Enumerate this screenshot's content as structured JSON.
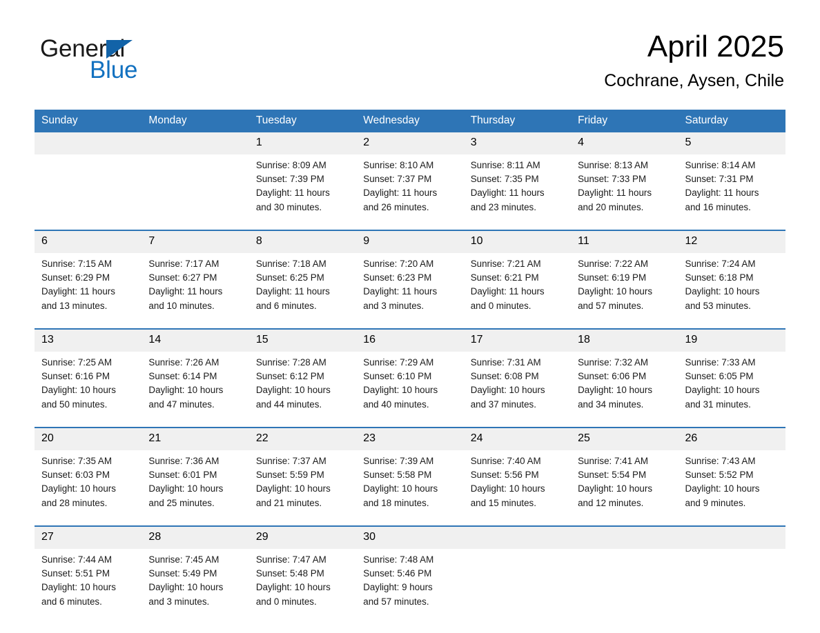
{
  "brand": {
    "name_part1": "General",
    "name_part2": "Blue",
    "triangle_color": "#1263a8",
    "blue_text_color": "#1271c0"
  },
  "header": {
    "month_title": "April 2025",
    "location": "Cochrane, Aysen, Chile",
    "header_bg_color": "#2e75b6",
    "daynum_bg_color": "#f0f0f0"
  },
  "weekday_headers": [
    "Sunday",
    "Monday",
    "Tuesday",
    "Wednesday",
    "Thursday",
    "Friday",
    "Saturday"
  ],
  "weeks": [
    {
      "days": [
        {
          "num": "",
          "sunrise": "",
          "sunset": "",
          "daylight_line1": "",
          "daylight_line2": "",
          "empty": true
        },
        {
          "num": "",
          "sunrise": "",
          "sunset": "",
          "daylight_line1": "",
          "daylight_line2": "",
          "empty": true
        },
        {
          "num": "1",
          "sunrise": "Sunrise: 8:09 AM",
          "sunset": "Sunset: 7:39 PM",
          "daylight_line1": "Daylight: 11 hours",
          "daylight_line2": "and 30 minutes.",
          "empty": false
        },
        {
          "num": "2",
          "sunrise": "Sunrise: 8:10 AM",
          "sunset": "Sunset: 7:37 PM",
          "daylight_line1": "Daylight: 11 hours",
          "daylight_line2": "and 26 minutes.",
          "empty": false
        },
        {
          "num": "3",
          "sunrise": "Sunrise: 8:11 AM",
          "sunset": "Sunset: 7:35 PM",
          "daylight_line1": "Daylight: 11 hours",
          "daylight_line2": "and 23 minutes.",
          "empty": false
        },
        {
          "num": "4",
          "sunrise": "Sunrise: 8:13 AM",
          "sunset": "Sunset: 7:33 PM",
          "daylight_line1": "Daylight: 11 hours",
          "daylight_line2": "and 20 minutes.",
          "empty": false
        },
        {
          "num": "5",
          "sunrise": "Sunrise: 8:14 AM",
          "sunset": "Sunset: 7:31 PM",
          "daylight_line1": "Daylight: 11 hours",
          "daylight_line2": "and 16 minutes.",
          "empty": false
        }
      ]
    },
    {
      "days": [
        {
          "num": "6",
          "sunrise": "Sunrise: 7:15 AM",
          "sunset": "Sunset: 6:29 PM",
          "daylight_line1": "Daylight: 11 hours",
          "daylight_line2": "and 13 minutes.",
          "empty": false
        },
        {
          "num": "7",
          "sunrise": "Sunrise: 7:17 AM",
          "sunset": "Sunset: 6:27 PM",
          "daylight_line1": "Daylight: 11 hours",
          "daylight_line2": "and 10 minutes.",
          "empty": false
        },
        {
          "num": "8",
          "sunrise": "Sunrise: 7:18 AM",
          "sunset": "Sunset: 6:25 PM",
          "daylight_line1": "Daylight: 11 hours",
          "daylight_line2": "and 6 minutes.",
          "empty": false
        },
        {
          "num": "9",
          "sunrise": "Sunrise: 7:20 AM",
          "sunset": "Sunset: 6:23 PM",
          "daylight_line1": "Daylight: 11 hours",
          "daylight_line2": "and 3 minutes.",
          "empty": false
        },
        {
          "num": "10",
          "sunrise": "Sunrise: 7:21 AM",
          "sunset": "Sunset: 6:21 PM",
          "daylight_line1": "Daylight: 11 hours",
          "daylight_line2": "and 0 minutes.",
          "empty": false
        },
        {
          "num": "11",
          "sunrise": "Sunrise: 7:22 AM",
          "sunset": "Sunset: 6:19 PM",
          "daylight_line1": "Daylight: 10 hours",
          "daylight_line2": "and 57 minutes.",
          "empty": false
        },
        {
          "num": "12",
          "sunrise": "Sunrise: 7:24 AM",
          "sunset": "Sunset: 6:18 PM",
          "daylight_line1": "Daylight: 10 hours",
          "daylight_line2": "and 53 minutes.",
          "empty": false
        }
      ]
    },
    {
      "days": [
        {
          "num": "13",
          "sunrise": "Sunrise: 7:25 AM",
          "sunset": "Sunset: 6:16 PM",
          "daylight_line1": "Daylight: 10 hours",
          "daylight_line2": "and 50 minutes.",
          "empty": false
        },
        {
          "num": "14",
          "sunrise": "Sunrise: 7:26 AM",
          "sunset": "Sunset: 6:14 PM",
          "daylight_line1": "Daylight: 10 hours",
          "daylight_line2": "and 47 minutes.",
          "empty": false
        },
        {
          "num": "15",
          "sunrise": "Sunrise: 7:28 AM",
          "sunset": "Sunset: 6:12 PM",
          "daylight_line1": "Daylight: 10 hours",
          "daylight_line2": "and 44 minutes.",
          "empty": false
        },
        {
          "num": "16",
          "sunrise": "Sunrise: 7:29 AM",
          "sunset": "Sunset: 6:10 PM",
          "daylight_line1": "Daylight: 10 hours",
          "daylight_line2": "and 40 minutes.",
          "empty": false
        },
        {
          "num": "17",
          "sunrise": "Sunrise: 7:31 AM",
          "sunset": "Sunset: 6:08 PM",
          "daylight_line1": "Daylight: 10 hours",
          "daylight_line2": "and 37 minutes.",
          "empty": false
        },
        {
          "num": "18",
          "sunrise": "Sunrise: 7:32 AM",
          "sunset": "Sunset: 6:06 PM",
          "daylight_line1": "Daylight: 10 hours",
          "daylight_line2": "and 34 minutes.",
          "empty": false
        },
        {
          "num": "19",
          "sunrise": "Sunrise: 7:33 AM",
          "sunset": "Sunset: 6:05 PM",
          "daylight_line1": "Daylight: 10 hours",
          "daylight_line2": "and 31 minutes.",
          "empty": false
        }
      ]
    },
    {
      "days": [
        {
          "num": "20",
          "sunrise": "Sunrise: 7:35 AM",
          "sunset": "Sunset: 6:03 PM",
          "daylight_line1": "Daylight: 10 hours",
          "daylight_line2": "and 28 minutes.",
          "empty": false
        },
        {
          "num": "21",
          "sunrise": "Sunrise: 7:36 AM",
          "sunset": "Sunset: 6:01 PM",
          "daylight_line1": "Daylight: 10 hours",
          "daylight_line2": "and 25 minutes.",
          "empty": false
        },
        {
          "num": "22",
          "sunrise": "Sunrise: 7:37 AM",
          "sunset": "Sunset: 5:59 PM",
          "daylight_line1": "Daylight: 10 hours",
          "daylight_line2": "and 21 minutes.",
          "empty": false
        },
        {
          "num": "23",
          "sunrise": "Sunrise: 7:39 AM",
          "sunset": "Sunset: 5:58 PM",
          "daylight_line1": "Daylight: 10 hours",
          "daylight_line2": "and 18 minutes.",
          "empty": false
        },
        {
          "num": "24",
          "sunrise": "Sunrise: 7:40 AM",
          "sunset": "Sunset: 5:56 PM",
          "daylight_line1": "Daylight: 10 hours",
          "daylight_line2": "and 15 minutes.",
          "empty": false
        },
        {
          "num": "25",
          "sunrise": "Sunrise: 7:41 AM",
          "sunset": "Sunset: 5:54 PM",
          "daylight_line1": "Daylight: 10 hours",
          "daylight_line2": "and 12 minutes.",
          "empty": false
        },
        {
          "num": "26",
          "sunrise": "Sunrise: 7:43 AM",
          "sunset": "Sunset: 5:52 PM",
          "daylight_line1": "Daylight: 10 hours",
          "daylight_line2": "and 9 minutes.",
          "empty": false
        }
      ]
    },
    {
      "days": [
        {
          "num": "27",
          "sunrise": "Sunrise: 7:44 AM",
          "sunset": "Sunset: 5:51 PM",
          "daylight_line1": "Daylight: 10 hours",
          "daylight_line2": "and 6 minutes.",
          "empty": false
        },
        {
          "num": "28",
          "sunrise": "Sunrise: 7:45 AM",
          "sunset": "Sunset: 5:49 PM",
          "daylight_line1": "Daylight: 10 hours",
          "daylight_line2": "and 3 minutes.",
          "empty": false
        },
        {
          "num": "29",
          "sunrise": "Sunrise: 7:47 AM",
          "sunset": "Sunset: 5:48 PM",
          "daylight_line1": "Daylight: 10 hours",
          "daylight_line2": "and 0 minutes.",
          "empty": false
        },
        {
          "num": "30",
          "sunrise": "Sunrise: 7:48 AM",
          "sunset": "Sunset: 5:46 PM",
          "daylight_line1": "Daylight: 9 hours",
          "daylight_line2": "and 57 minutes.",
          "empty": false
        },
        {
          "num": "",
          "sunrise": "",
          "sunset": "",
          "daylight_line1": "",
          "daylight_line2": "",
          "empty": true
        },
        {
          "num": "",
          "sunrise": "",
          "sunset": "",
          "daylight_line1": "",
          "daylight_line2": "",
          "empty": true
        },
        {
          "num": "",
          "sunrise": "",
          "sunset": "",
          "daylight_line1": "",
          "daylight_line2": "",
          "empty": true
        }
      ]
    }
  ]
}
